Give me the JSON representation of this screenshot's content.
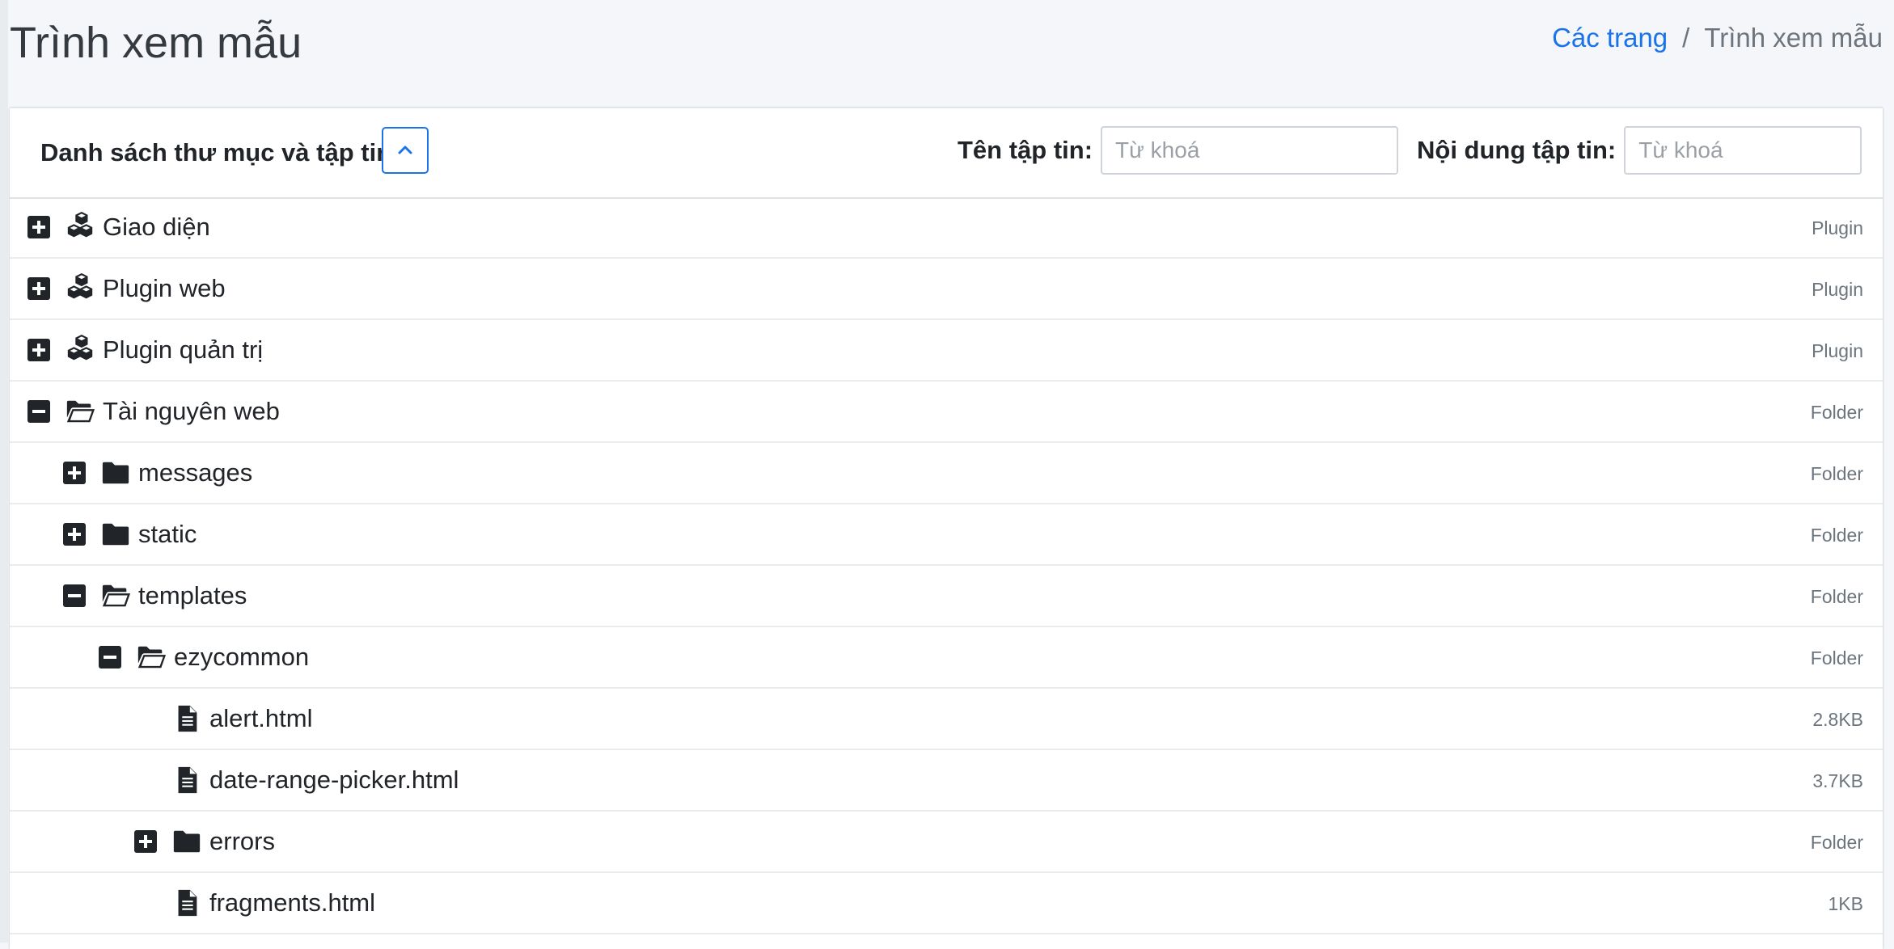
{
  "page": {
    "title": "Trình xem mẫu"
  },
  "breadcrumb": {
    "parent": "Các trang",
    "separator": "/",
    "current": "Trình xem mẫu"
  },
  "card": {
    "title": "Danh sách thư mục và tập tin",
    "collapse_icon": "chevron-up-icon",
    "filters": {
      "file_name": {
        "label": "Tên tập tin:",
        "placeholder": "Từ khoá",
        "value": ""
      },
      "file_content": {
        "label": "Nội dung tập tin:",
        "placeholder": "Từ khoá",
        "value": ""
      }
    }
  },
  "tree": [
    {
      "name": "Giao diện",
      "meta": "Plugin",
      "level": 0,
      "icon": "cubes-icon",
      "toggle": "plus"
    },
    {
      "name": "Plugin web",
      "meta": "Plugin",
      "level": 0,
      "icon": "cubes-icon",
      "toggle": "plus"
    },
    {
      "name": "Plugin quản trị",
      "meta": "Plugin",
      "level": 0,
      "icon": "cubes-icon",
      "toggle": "plus"
    },
    {
      "name": "Tài nguyên web",
      "meta": "Folder",
      "level": 0,
      "icon": "folder-open-icon",
      "toggle": "minus"
    },
    {
      "name": "messages",
      "meta": "Folder",
      "level": 1,
      "icon": "folder-icon",
      "toggle": "plus"
    },
    {
      "name": "static",
      "meta": "Folder",
      "level": 1,
      "icon": "folder-icon",
      "toggle": "plus"
    },
    {
      "name": "templates",
      "meta": "Folder",
      "level": 1,
      "icon": "folder-open-icon",
      "toggle": "minus"
    },
    {
      "name": "ezycommon",
      "meta": "Folder",
      "level": 2,
      "icon": "folder-open-icon",
      "toggle": "minus"
    },
    {
      "name": "alert.html",
      "meta": "2.8KB",
      "level": 3,
      "icon": "file-icon",
      "toggle": "none"
    },
    {
      "name": "date-range-picker.html",
      "meta": "3.7KB",
      "level": 3,
      "icon": "file-icon",
      "toggle": "none"
    },
    {
      "name": "errors",
      "meta": "Folder",
      "level": 3,
      "icon": "folder-icon",
      "toggle": "plus"
    },
    {
      "name": "fragments.html",
      "meta": "1KB",
      "level": 3,
      "icon": "file-icon",
      "toggle": "none"
    }
  ]
}
